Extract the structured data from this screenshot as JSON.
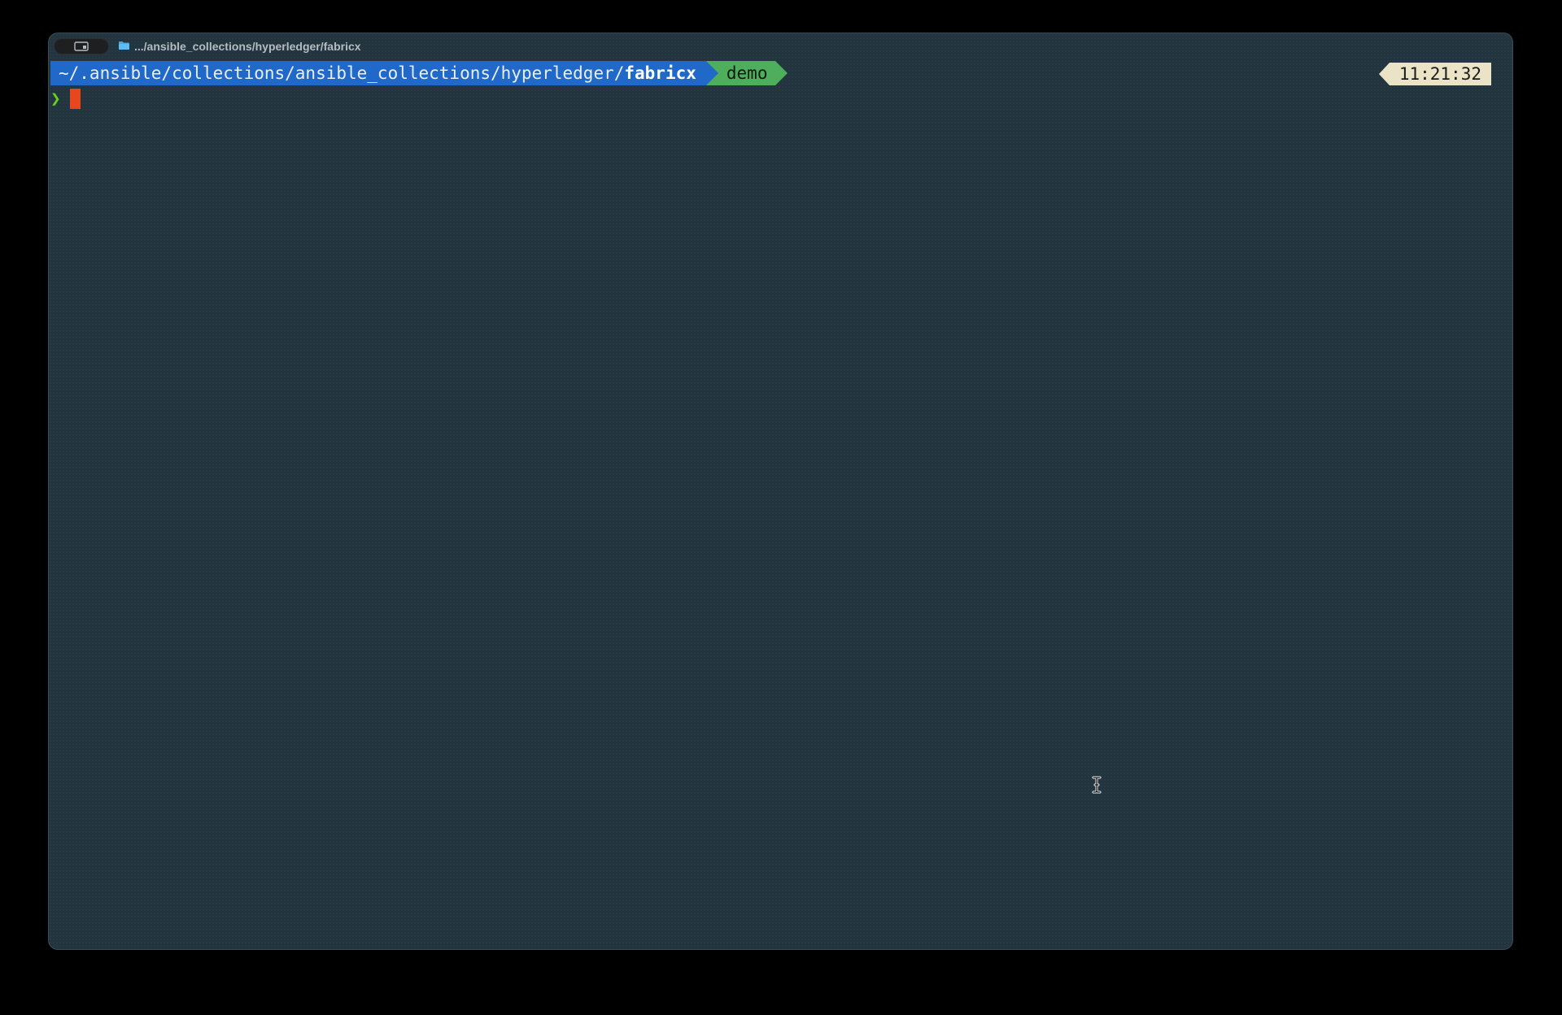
{
  "window": {
    "tab_title": ".../ansible_collections/hyperledger/fabricx",
    "tab_toggle_icon": "tab-overview-icon",
    "folder_icon": "folder-icon"
  },
  "prompt": {
    "path_prefix": "~/.ansible/collections/ansible_collections/hyperledger/",
    "path_current_dir": "fabricx",
    "branch": "demo",
    "time": "11:21:32",
    "chevron": "❯",
    "colors": {
      "path_segment": "#2169c8",
      "branch_segment": "#4fae5c",
      "time_segment": "#ebe3c6",
      "chevron": "#66d11f",
      "cursor": "#e8471e",
      "background": "#22343e"
    }
  },
  "input": {
    "value": ""
  }
}
